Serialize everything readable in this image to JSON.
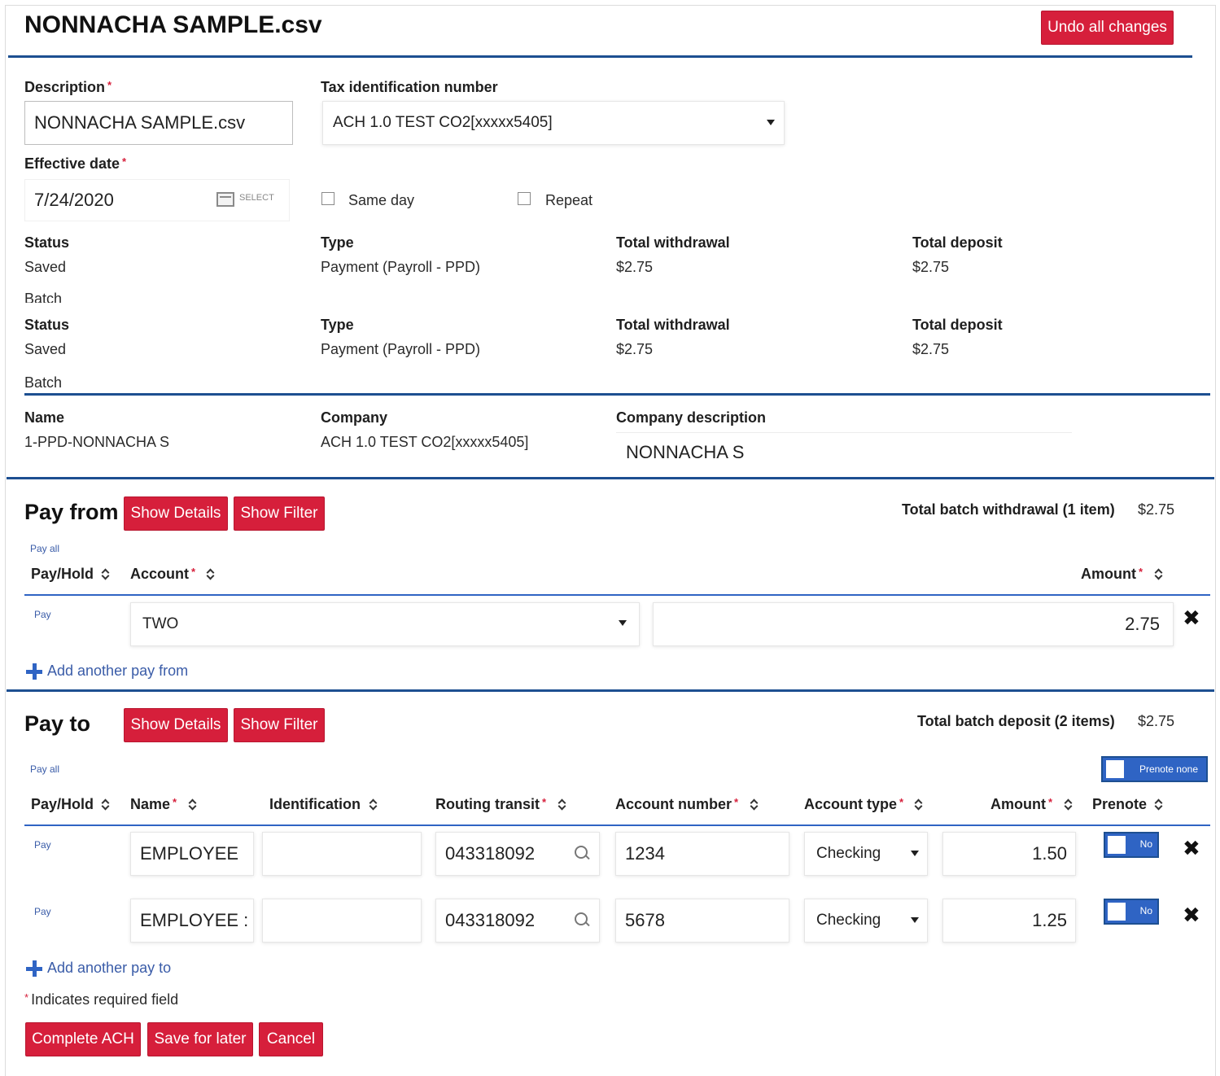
{
  "header": {
    "title": "NONNACHA SAMPLE.csv",
    "undo_label": "Undo all changes"
  },
  "form": {
    "description_label": "Description",
    "description_value": "NONNACHA SAMPLE.csv",
    "tax_id_label": "Tax identification number",
    "tax_id_value": "ACH 1.0 TEST CO2[xxxxx5405]",
    "effective_date_label": "Effective date",
    "effective_date_value": "7/24/2020",
    "select_label": "SELECT",
    "same_day_label": "Same day",
    "repeat_label": "Repeat",
    "required_mark": "*"
  },
  "summary": [
    {
      "status_label": "Status",
      "status_value": "Saved",
      "type_label": "Type",
      "type_value": "Payment (Payroll - PPD)",
      "withdrawal_label": "Total withdrawal",
      "withdrawal_value": "$2.75",
      "deposit_label": "Total deposit",
      "deposit_value": "$2.75",
      "batch_label": "Batch"
    },
    {
      "status_label": "Status",
      "status_value": "Saved",
      "type_label": "Type",
      "type_value": "Payment (Payroll - PPD)",
      "withdrawal_label": "Total withdrawal",
      "withdrawal_value": "$2.75",
      "deposit_label": "Total deposit",
      "deposit_value": "$2.75",
      "batch_label": "Batch"
    }
  ],
  "batch": {
    "name_label": "Name",
    "name_value": "1-PPD-NONNACHA S",
    "company_label": "Company",
    "company_value": "ACH 1.0 TEST CO2[xxxxx5405]",
    "company_desc_label": "Company description",
    "company_desc_value": "NONNACHA S"
  },
  "pay_from": {
    "title": "Pay from",
    "show_details": "Show Details",
    "show_filter": "Show Filter",
    "total_label": "Total batch withdrawal (1 item)",
    "total_value": "$2.75",
    "pay_all": "Pay all",
    "col_payhold": "Pay/Hold",
    "col_account": "Account",
    "col_amount": "Amount",
    "row": {
      "pay": "Pay",
      "account": "TWO",
      "amount": "2.75"
    },
    "add_link": "Add another pay from"
  },
  "pay_to": {
    "title": "Pay to",
    "show_details": "Show Details",
    "show_filter": "Show Filter",
    "total_label": "Total batch deposit (2 items)",
    "total_value": "$2.75",
    "pay_all": "Pay all",
    "prenote_none": "Prenote none",
    "columns": {
      "payhold": "Pay/Hold",
      "name": "Name",
      "identification": "Identification",
      "routing": "Routing transit",
      "account_number": "Account number",
      "account_type": "Account type",
      "amount": "Amount",
      "prenote": "Prenote"
    },
    "rows": [
      {
        "pay": "Pay",
        "name": "EMPLOYEE",
        "identification": "",
        "routing": "043318092",
        "account_number": "1234",
        "account_type": "Checking",
        "amount": "1.50",
        "prenote": "No"
      },
      {
        "pay": "Pay",
        "name": "EMPLOYEE :",
        "identification": "",
        "routing": "043318092",
        "account_number": "5678",
        "account_type": "Checking",
        "amount": "1.25",
        "prenote": "No"
      }
    ],
    "add_link": "Add another pay to"
  },
  "footer": {
    "required_note": "Indicates required field",
    "complete_label": "Complete ACH",
    "save_label": "Save for later",
    "cancel_label": "Cancel"
  },
  "colors": {
    "accent_red": "#d61f3b",
    "rule_blue": "#1d4f91",
    "link_blue": "#3a5ca8"
  }
}
